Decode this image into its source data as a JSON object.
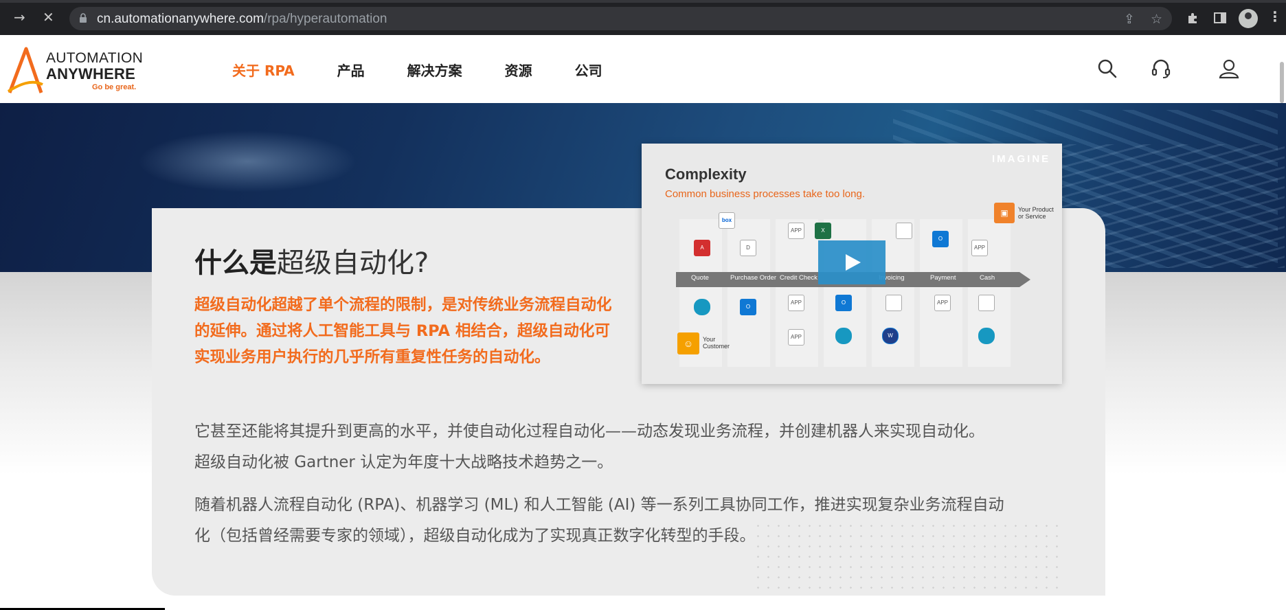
{
  "browser": {
    "url_host": "cn.automationanywhere.com",
    "url_path": "/rpa/hyperautomation"
  },
  "logo": {
    "line1": "AUTOMATION",
    "line2": "ANYWHERE",
    "tagline": "Go be great."
  },
  "nav": {
    "items": [
      {
        "label": "关于 RPA",
        "active": true
      },
      {
        "label": "产品",
        "active": false
      },
      {
        "label": "解决方案",
        "active": false
      },
      {
        "label": "资源",
        "active": false
      },
      {
        "label": "公司",
        "active": false
      }
    ]
  },
  "content": {
    "title_bold": "什么是",
    "title_rest": "超级自动化?",
    "lead": "超级自动化超越了单个流程的限制，是对传统业务流程自动化的延伸。通过将人工智能工具与 RPA 相结合，超级自动化可实现业务用户执行的几乎所有重复性任务的自动化。",
    "para1_line1": "它甚至还能将其提升到更高的水平，并使自动化过程自动化——动态发现业务流程，并创建机器人来实现自动化。",
    "para1_line2": "超级自动化被 Gartner 认定为年度十大战略技术趋势之一。",
    "para2_line1": "随着机器人流程自动化 (RPA)、机器学习 (ML) 和人工智能 (AI) 等一系列工具协同工作，推进实现复杂业务流程自动",
    "para2_line2": "化（包括曾经需要专家的领域），超级自动化成为了实现真正数字化转型的手段。"
  },
  "video": {
    "title": "Complexity",
    "subtitle": "Common business processes take too long.",
    "brand": "IMAGINE",
    "stages": [
      "Quote",
      "Purchase Order",
      "Credit Check",
      "Invoicing",
      "Payment",
      "Cash"
    ],
    "your_customer": "Your Customer",
    "your_product": "Your Product or Service"
  }
}
